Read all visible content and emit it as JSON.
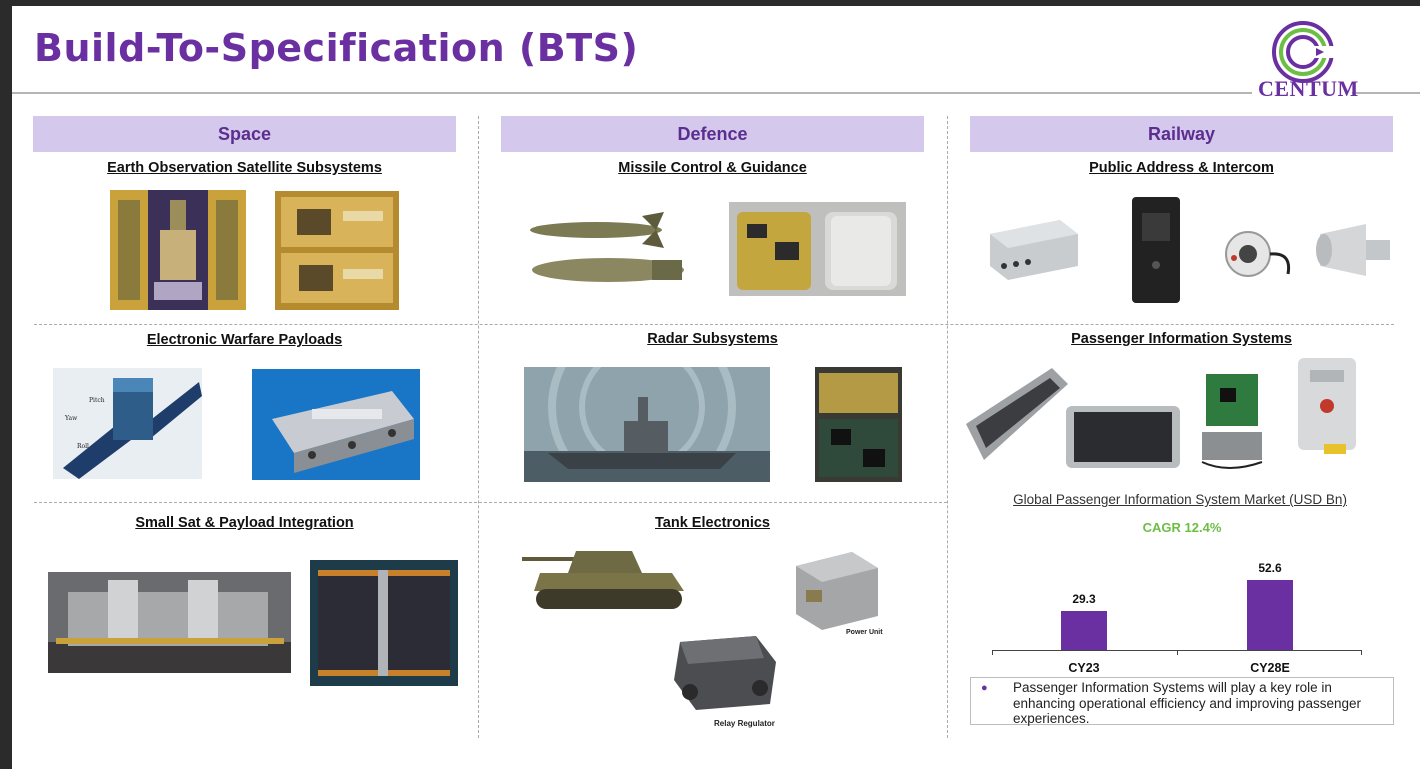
{
  "title": "Build-To-Specification (BTS)",
  "logo": {
    "text": "CENTUM"
  },
  "columns": [
    {
      "header": "Space",
      "sections": [
        "Earth Observation Satellite Subsystems",
        "Electronic Warfare Payloads",
        "Small Sat & Payload Integration"
      ]
    },
    {
      "header": "Defence",
      "sections": [
        "Missile Control & Guidance",
        "Radar Subsystems",
        "Tank Electronics"
      ]
    },
    {
      "header": "Railway",
      "sections": [
        "Public Address & Intercom",
        "Passenger Information Systems"
      ]
    }
  ],
  "image_captions": {
    "power_unit": "Power Unit",
    "relay_regulator": "Relay Regulator"
  },
  "satellite_axes": {
    "pitch": "Pitch",
    "yaw": "Yaw",
    "roll": "Roll"
  },
  "market": {
    "title": "Global Passenger Information System Market (USD Bn)",
    "cagr": "CAGR 12.4%"
  },
  "chart_data": {
    "type": "bar",
    "title": "Global Passenger Information System Market (USD Bn)",
    "categories": [
      "CY23",
      "CY28E"
    ],
    "values": [
      29.3,
      52.6
    ],
    "annotation": "CAGR 12.4%",
    "color": "#6a2fa0",
    "ylim": [
      0,
      60
    ]
  },
  "note": "Passenger Information Systems will play a key role in enhancing operational efficiency and improving passenger experiences.",
  "colors": {
    "accent": "#6a2fa0",
    "header_bg": "#d4c9ec",
    "cagr": "#6cbe45"
  }
}
